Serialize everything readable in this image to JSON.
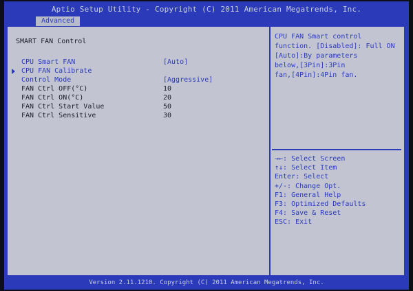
{
  "header": {
    "title": "Aptio Setup Utility - Copyright (C) 2011 American Megatrends, Inc."
  },
  "tabs": [
    {
      "label": "Advanced"
    }
  ],
  "section": {
    "title": "SMART FAN Control"
  },
  "settings": [
    {
      "label": "CPU Smart FAN",
      "value": "[Auto]"
    },
    {
      "label": "CPU FAN Calibrate",
      "value": ""
    },
    {
      "label": "Control Mode",
      "value": "[Aggressive]"
    },
    {
      "label": "FAN Ctrl OFF(°C)",
      "value": "10"
    },
    {
      "label": "FAN Ctrl ON(°C)",
      "value": "20"
    },
    {
      "label": "FAN Ctrl Start Value",
      "value": "50"
    },
    {
      "label": "FAN Ctrl Sensitive",
      "value": "30"
    }
  ],
  "help": {
    "text": "CPU FAN Smart control\nfunction. [Disabled]: Full ON\n[Auto]:By parameters\nbelow,[3Pin]:3Pin\nfan,[4Pin]:4Pin fan."
  },
  "keys": [
    "→←: Select Screen",
    "↑↓: Select Item",
    "Enter: Select",
    "+/-: Change Opt.",
    "F1: General Help",
    "F3: Optimized Defaults",
    "F4: Save & Reset",
    "ESC: Exit"
  ],
  "footer": {
    "text": "Version 2.11.1210. Copyright (C) 2011 American Megatrends, Inc."
  },
  "colors": {
    "bios_blue": "#2a3ab8",
    "panel_gray": "#c2c5d1",
    "text_dark": "#1a1d2a",
    "text_light": "#c9cfe0"
  }
}
